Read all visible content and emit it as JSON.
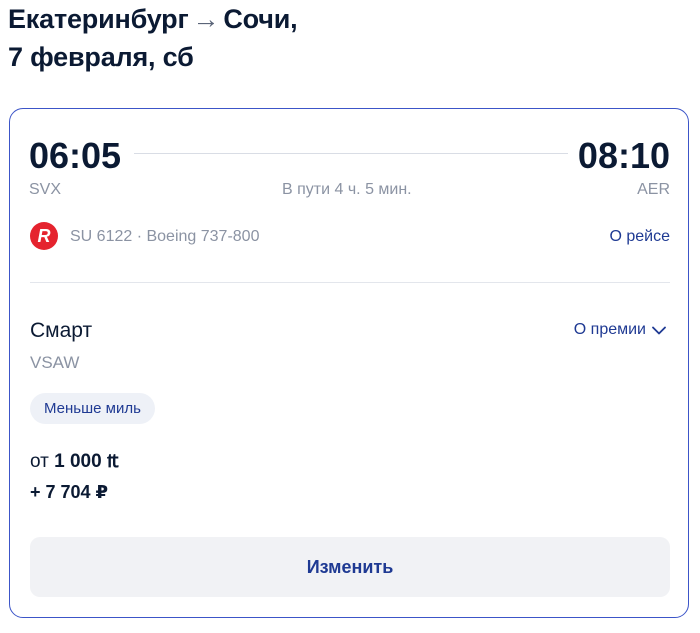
{
  "header": {
    "origin_city": "Екатеринбург",
    "arrow": "→",
    "destination_city": "Сочи,",
    "date": "7 февраля, сб"
  },
  "flight": {
    "departure_time": "06:05",
    "arrival_time": "08:10",
    "departure_code": "SVX",
    "arrival_code": "AER",
    "duration": "В пути 4 ч. 5 мин.",
    "airline_logo_letter": "R",
    "flight_info": "SU 6122 · Boeing 737-800",
    "about_flight_link": "О рейсе"
  },
  "fare": {
    "name": "Смарт",
    "code": "VSAW",
    "about_premium_link": "О премии",
    "badge": "Меньше миль",
    "price_prefix": "от",
    "price_miles": "1 000",
    "miles_symbol": "₶",
    "price_rub": "+ 7 704 ₽"
  },
  "actions": {
    "change_label": "Изменить"
  },
  "colors": {
    "accent": "#1f3a93",
    "card_border": "#3c55c8",
    "airline_red": "#e5232e",
    "muted_text": "#8b93a3"
  }
}
